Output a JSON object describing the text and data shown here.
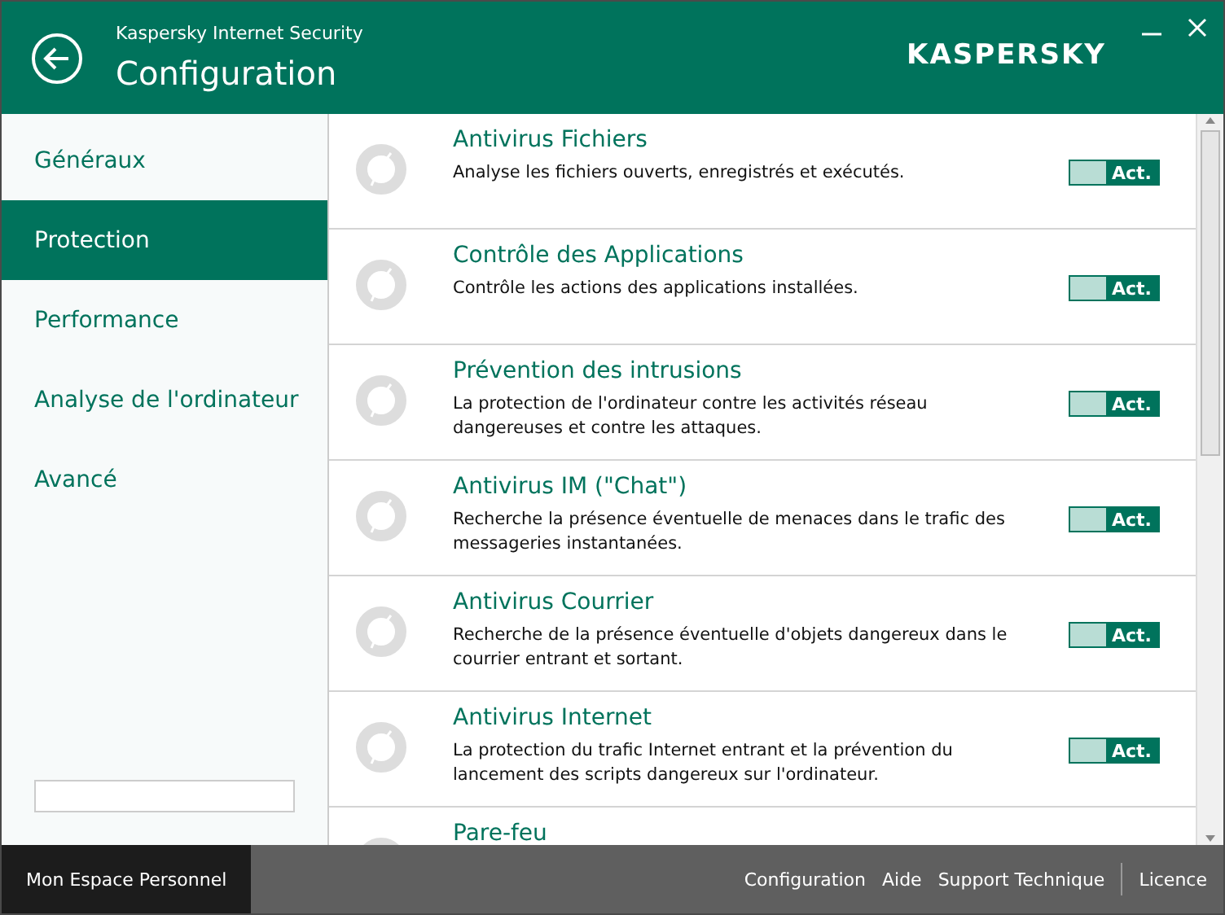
{
  "window": {
    "app_name": "Kaspersky Internet Security",
    "title": "Configuration",
    "logo": "KASPERSKY"
  },
  "sidebar": {
    "items": [
      {
        "label": "Généraux",
        "selected": false
      },
      {
        "label": "Protection",
        "selected": true
      },
      {
        "label": "Performance",
        "selected": false
      },
      {
        "label": "Analyse de l'ordinateur",
        "selected": false
      },
      {
        "label": "Avancé",
        "selected": false
      }
    ]
  },
  "components": [
    {
      "title": "Antivirus Fichiers",
      "description": "Analyse les fichiers ouverts, enregistrés et exécutés.",
      "on": true,
      "switch_label": "Act."
    },
    {
      "title": "Contrôle des Applications",
      "description": "Contrôle les actions des applications installées.",
      "on": true,
      "switch_label": "Act."
    },
    {
      "title": "Prévention des intrusions",
      "description": "La protection de l'ordinateur contre les activités réseau dangereuses et contre les attaques.",
      "on": true,
      "switch_label": "Act."
    },
    {
      "title": "Antivirus IM (\"Chat\")",
      "description": "Recherche la présence éventuelle de menaces dans le trafic des messageries instantanées.",
      "on": true,
      "switch_label": "Act."
    },
    {
      "title": "Antivirus Courrier",
      "description": "Recherche de la présence éventuelle d'objets dangereux dans le courrier entrant et sortant.",
      "on": true,
      "switch_label": "Act."
    },
    {
      "title": "Antivirus Internet",
      "description": "La protection du trafic Internet entrant et la prévention du lancement des scripts dangereux sur l'ordinateur.",
      "on": true,
      "switch_label": "Act."
    },
    {
      "title": "Pare-feu"
    }
  ],
  "footer": {
    "account": "Mon Espace Personnel",
    "links": [
      "Configuration",
      "Aide",
      "Support Technique"
    ],
    "license": "Licence"
  }
}
